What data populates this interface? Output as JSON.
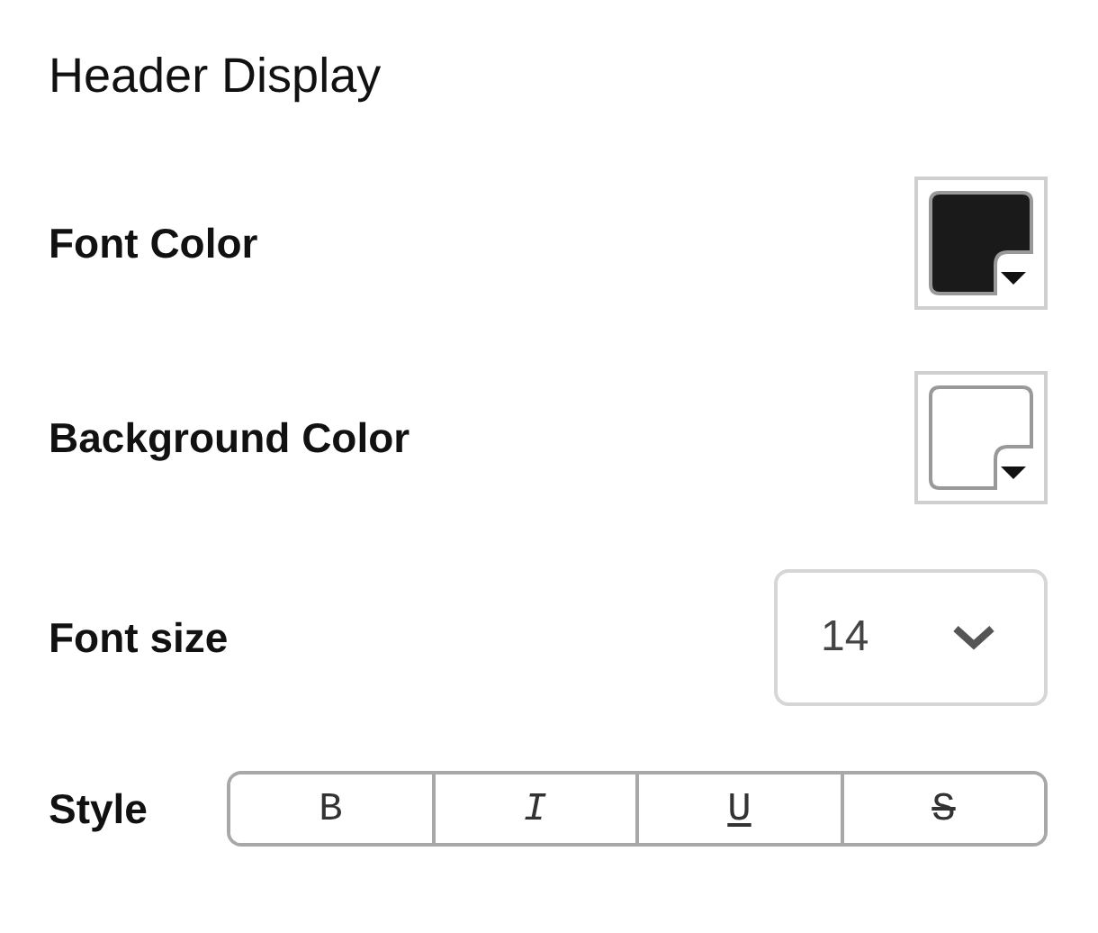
{
  "section_title": "Header Display",
  "color_settings": [
    {
      "label": "Font Color",
      "color": "#1a1a1a"
    },
    {
      "label": "Background Color",
      "color": "#ffffff"
    }
  ],
  "font_size": {
    "label": "Font size",
    "value": "14"
  },
  "style": {
    "label": "Style",
    "buttons": [
      {
        "glyph": "B",
        "kind": "bold",
        "selected": false
      },
      {
        "glyph": "I",
        "kind": "italic",
        "selected": false
      },
      {
        "glyph": "U",
        "kind": "underline",
        "selected": false
      },
      {
        "glyph": "S",
        "kind": "strike",
        "selected": false
      }
    ]
  }
}
